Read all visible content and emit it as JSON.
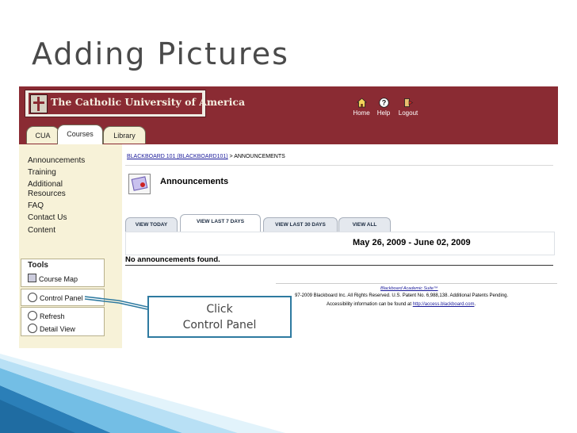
{
  "slide": {
    "title": "Adding Pictures"
  },
  "banner": {
    "institution": "The Catholic University of America",
    "nav": [
      {
        "label": "Home",
        "icon": "home-icon"
      },
      {
        "label": "Help",
        "icon": "help-icon"
      },
      {
        "label": "Logout",
        "icon": "logout-icon"
      }
    ],
    "tabs": [
      "CUA",
      "Courses",
      "Library"
    ],
    "active_tab": "Courses"
  },
  "sidebar": {
    "links": [
      "Announcements",
      "Training",
      "Additional",
      "Resources",
      "FAQ",
      "Contact Us",
      "Content"
    ],
    "tools_title": "Tools",
    "tools": [
      {
        "label": "Course Map",
        "icon": "map-icon"
      },
      {
        "label": "Control Panel",
        "icon": "control-panel-icon"
      },
      {
        "label": "Refresh",
        "icon": "refresh-icon"
      },
      {
        "label": "Detail View",
        "icon": "detail-view-icon"
      }
    ]
  },
  "main": {
    "breadcrumb_link": "BLACKBOARD 101 (BLACKBOARD101)",
    "breadcrumb_rest": " > ANNOUNCEMENTS",
    "page_title": "Announcements",
    "view_tabs": [
      "VIEW TODAY",
      "VIEW LAST 7 DAYS",
      "VIEW LAST 30 DAYS",
      "VIEW ALL"
    ],
    "active_view_tab": "VIEW LAST 7 DAYS",
    "date_range": "May 26, 2009 - June 02, 2009",
    "empty_message": "No announcements found.",
    "footer_suite": "Blackboard Academic Suite™",
    "footer_copyright": "97-2009 Blackboard Inc. All Rights Reserved. U.S. Patent No. 6,988,138. Additional Patents Pending.",
    "footer_access_prefix": "Accessibility information can be found at ",
    "footer_access_link": "http://access.blackboard.com",
    "footer_access_suffix": "."
  },
  "callout": {
    "line1": "Click",
    "line2": "Control Panel"
  },
  "colors": {
    "banner": "#8a2b33",
    "sidebar": "#f7f2d8",
    "callout_border": "#2e7aa0",
    "deco": "#3a9bd0"
  }
}
